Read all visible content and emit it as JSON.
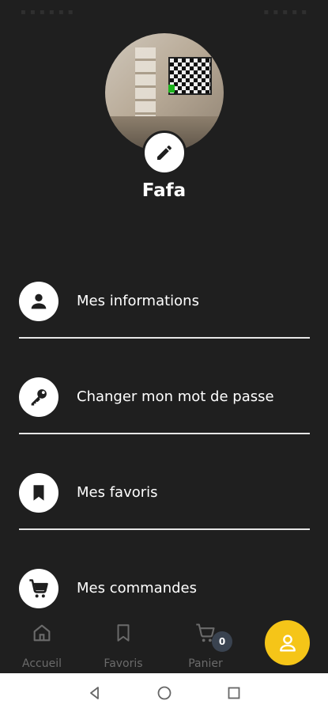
{
  "profile": {
    "name": "Fafa"
  },
  "menu": {
    "items": [
      {
        "label": "Mes informations",
        "icon": "person-icon"
      },
      {
        "label": "Changer mon mot de passe",
        "icon": "key-icon"
      },
      {
        "label": "Mes favoris",
        "icon": "bookmark-icon"
      },
      {
        "label": "Mes commandes",
        "icon": "cart-icon"
      }
    ]
  },
  "bottom_nav": {
    "items": [
      {
        "label": "Accueil",
        "icon": "home-icon"
      },
      {
        "label": "Favoris",
        "icon": "bookmark-icon"
      },
      {
        "label": "Panier",
        "icon": "cart-icon",
        "badge": "0"
      }
    ],
    "active_item": "profile",
    "active_color": "#f5c518"
  }
}
